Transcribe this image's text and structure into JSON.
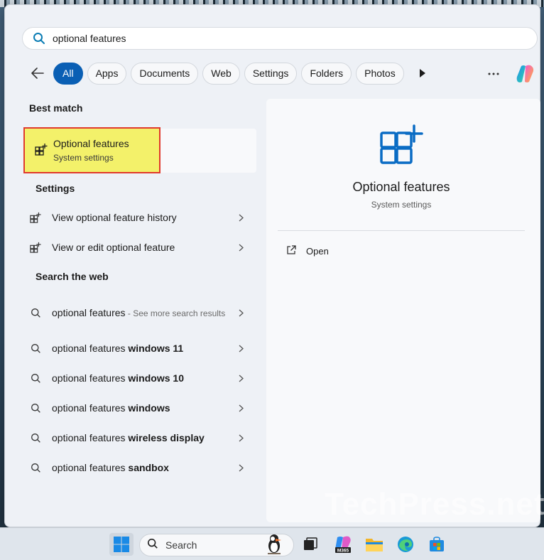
{
  "search": {
    "value": "optional features"
  },
  "filters": [
    "All",
    "Apps",
    "Documents",
    "Web",
    "Settings",
    "Folders",
    "Photos"
  ],
  "sections": {
    "best_match": "Best match",
    "settings": "Settings",
    "search_web": "Search the web"
  },
  "best_match": {
    "title": "Optional features",
    "subtitle": "System settings"
  },
  "settings_items": [
    {
      "label": "View optional feature history"
    },
    {
      "label": "View or edit optional feature"
    }
  ],
  "web_items": [
    {
      "prefix": "optional features",
      "bold": "",
      "suffix": " - See more search results"
    },
    {
      "prefix": "optional features ",
      "bold": "windows 11",
      "suffix": ""
    },
    {
      "prefix": "optional features ",
      "bold": "windows 10",
      "suffix": ""
    },
    {
      "prefix": "optional features ",
      "bold": "windows",
      "suffix": ""
    },
    {
      "prefix": "optional features ",
      "bold": "wireless display",
      "suffix": ""
    },
    {
      "prefix": "optional features ",
      "bold": "sandbox",
      "suffix": ""
    }
  ],
  "preview": {
    "title": "Optional features",
    "subtitle": "System settings",
    "open_label": "Open"
  },
  "watermark": "TechPress.net",
  "taskbar": {
    "search_label": "Search",
    "m365_badge": "M365"
  },
  "colors": {
    "accent": "#0a5fb4",
    "highlight": "#f3f16a",
    "highlight_border": "#e0392d"
  }
}
